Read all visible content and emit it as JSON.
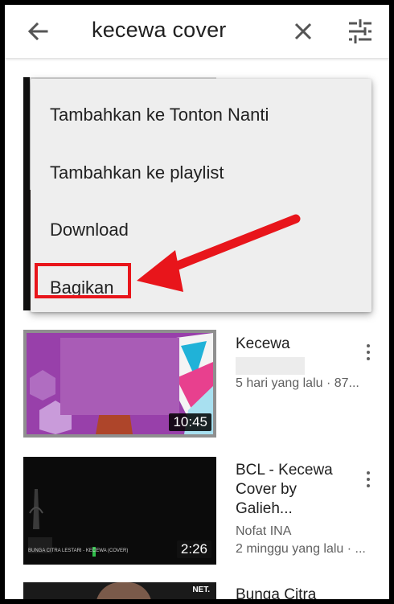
{
  "search": {
    "query": "kecewa cover"
  },
  "icons": {
    "back": "arrow-back-icon",
    "clear": "close-icon",
    "filter": "tune-icon",
    "more": "more-vert-icon"
  },
  "menu": {
    "items": [
      {
        "label": "Tambahkan ke Tonton Nanti"
      },
      {
        "label": "Tambahkan ke playlist"
      },
      {
        "label": "Download"
      },
      {
        "label": "Bagikan"
      }
    ],
    "highlighted_item": "Bagikan",
    "highlight_color": "#e8151b"
  },
  "videos": [
    {
      "title": "Kecewa",
      "channel": "",
      "meta": "5 hari yang lalu · 87...",
      "duration": "10:45"
    },
    {
      "title": "BCL - Kecewa Cover by Galieh...",
      "channel": "Nofat INA",
      "meta": "2 minggu yang lalu · ...",
      "duration": "2:26",
      "thumb_caption": "BUNGA CITRA LESTARI - KECEWA (COVER)"
    },
    {
      "title": "Bunga Citra"
    }
  ]
}
